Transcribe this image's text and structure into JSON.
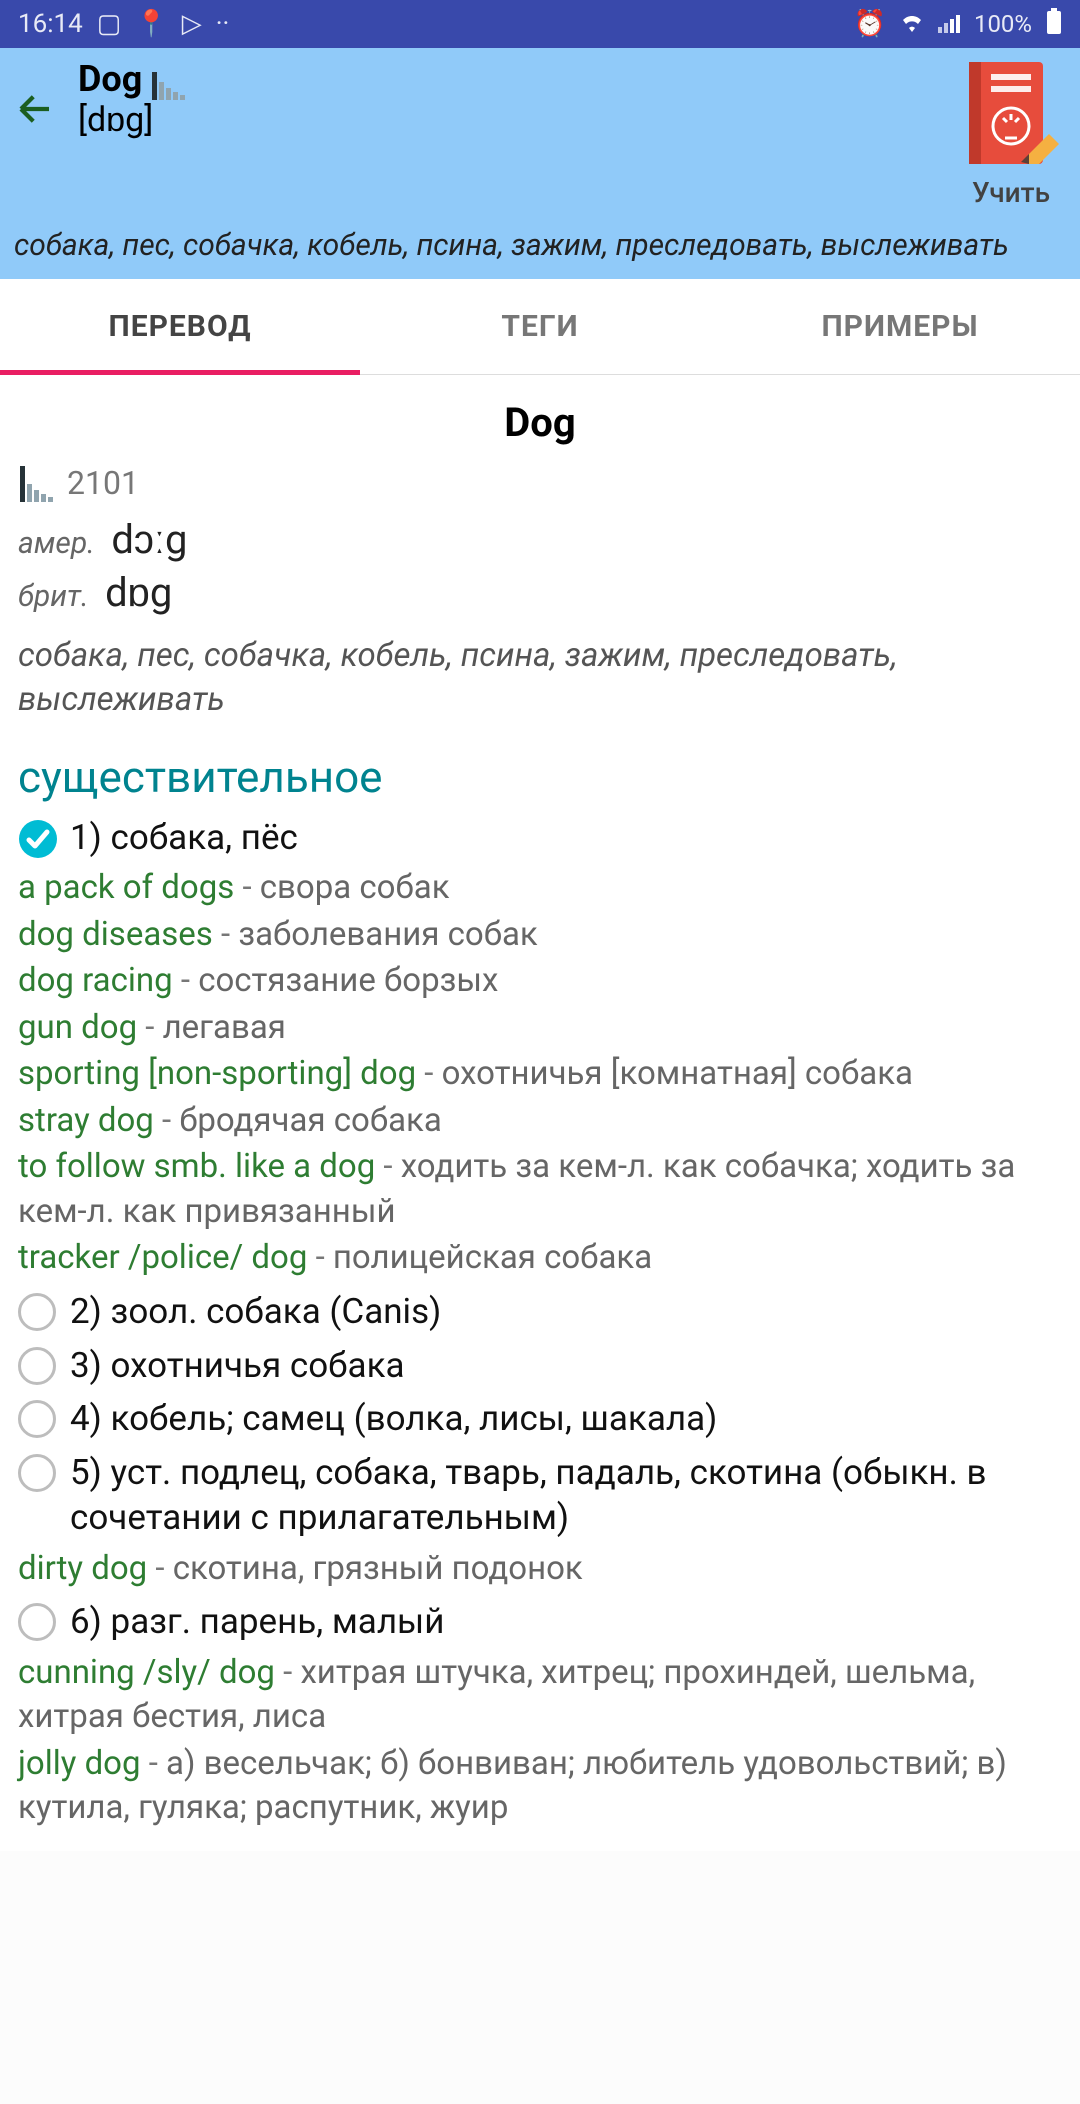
{
  "status": {
    "time": "16:14",
    "battery": "100%"
  },
  "header": {
    "word": "Dog",
    "ipa": "[dɒg]",
    "brief": "собака, пес, собачка, кобель, псина, зажим, преследовать, выслеживать",
    "learn": "Учить"
  },
  "tabs": {
    "items": [
      "ПЕРЕВОД",
      "ТЕГИ",
      "ПРИМЕРЫ"
    ],
    "active": 0
  },
  "entry": {
    "title": "Dog",
    "freq": "2101",
    "pron": [
      {
        "tag": "амер.",
        "ipa": "dɔːg"
      },
      {
        "tag": "брит.",
        "ipa": "dɒg"
      }
    ],
    "brief": "собака, пес, собачка, кобель, псина, зажим, преследовать, выслеживать",
    "pos": "существительное",
    "senses": [
      {
        "num": "1)",
        "text": "собака, пёс",
        "checked": true,
        "phrases": [
          {
            "en": "a pack of dogs",
            "ru": "свора собак"
          },
          {
            "en": "dog diseases",
            "ru": "заболевания собак"
          },
          {
            "en": "dog racing",
            "ru": "состязание борзых"
          },
          {
            "en": "gun dog",
            "ru": "легавая"
          },
          {
            "en": "sporting [non-sporting] dog",
            "ru": "охотничья [комнатная] собака"
          },
          {
            "en": "stray dog",
            "ru": "бродячая собака"
          },
          {
            "en": "to follow smb. like a dog",
            "ru": "ходить за кем-л. как собачка; ходить за кем-л. как привязанный"
          },
          {
            "en": "tracker /police/ dog",
            "ru": "полицейская собака"
          }
        ]
      },
      {
        "num": "2)",
        "text": "зоол. собака (Canis)",
        "checked": false,
        "phrases": []
      },
      {
        "num": "3)",
        "text": "охотничья собака",
        "checked": false,
        "phrases": []
      },
      {
        "num": "4)",
        "text": "кобель; самец (волка, лисы, шакала)",
        "checked": false,
        "phrases": []
      },
      {
        "num": "5)",
        "text": "уст. подлец, собака, тварь, падаль, скотина (обыкн. в сочетании с прилагательным)",
        "checked": false,
        "phrases": [
          {
            "en": "dirty dog",
            "ru": "скотина, грязный подонок"
          }
        ]
      },
      {
        "num": "6)",
        "text": "разг. парень, малый",
        "checked": false,
        "phrases": [
          {
            "en": "cunning /sly/ dog",
            "ru": "хитрая штучка, хитрец; прохиндей, шельма, хитрая бестия, лиса"
          },
          {
            "en": "jolly dog",
            "ru": "а) весельчак; б) бонвиван; любитель удовольствий; в) кутила, гуляка; распутник, жуир"
          }
        ]
      }
    ]
  }
}
